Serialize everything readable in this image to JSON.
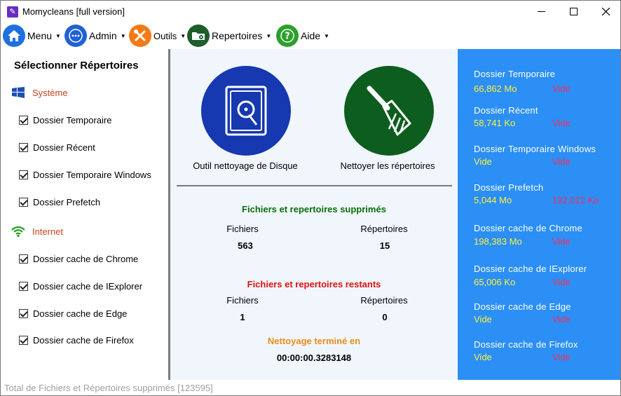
{
  "window": {
    "title": "Momycleans [full version]",
    "controls": {
      "minimize": "—",
      "maximize": "☐",
      "close": "✕"
    }
  },
  "menubar": {
    "items": [
      {
        "label": "Menu",
        "icon": "home-icon",
        "color": "#1e6fe0"
      },
      {
        "label": "Admin",
        "icon": "dots-icon",
        "color": "#1f62d6"
      },
      {
        "label": "Outils",
        "icon": "tools-icon",
        "color": "#f47a14"
      },
      {
        "label": "Repertoires",
        "icon": "folder-gear-icon",
        "color": "#1d5e2b"
      },
      {
        "label": "Aide",
        "icon": "help-icon",
        "color": "#2ca02c"
      }
    ]
  },
  "left": {
    "title": "Sélectionner Répertoires",
    "groups": [
      {
        "label": "Système",
        "icon": "windows-icon",
        "items": [
          "Dossier Temporaire",
          "Dossier Récent",
          "Dossier Temporaire Windows",
          "Dossier Prefetch"
        ]
      },
      {
        "label": "Internet",
        "icon": "wifi-icon",
        "items": [
          "Dossier cache de Chrome",
          "Dossier cache de IExplorer",
          "Dossier cache de Edge",
          "Dossier cache de Firefox"
        ]
      }
    ]
  },
  "center": {
    "disk_tool_label": "Outil nettoyage de Disque",
    "clean_dirs_label": "Nettoyer les répertoires",
    "deleted_title": "Fichiers et repertoires supprimés",
    "remaining_title": "Fichiers et repertoires restants",
    "col_files": "Fichiers",
    "col_dirs": "Répertoires",
    "deleted_files": "563",
    "deleted_dirs": "15",
    "remaining_files": "1",
    "remaining_dirs": "0",
    "done_title": "Nettoyage terminé en",
    "done_time": "00:00:00.3283148",
    "colors": {
      "deleted": "#0a6e0a",
      "remaining": "#e01010",
      "done": "#f08a1a",
      "disk_circle": "#1638b0",
      "broom_circle": "#0d5e1e"
    }
  },
  "right": {
    "items": [
      {
        "name": "Dossier Temporaire",
        "v1": "66,862 Mo",
        "v2": "Vide"
      },
      {
        "name": "Dossier Récent",
        "v1": "58,741 Ko",
        "v2": "Vide"
      },
      {
        "name": "Dossier Temporaire Windows",
        "v1": "Vide",
        "v2": "Vide"
      },
      {
        "name": "Dossier Prefetch",
        "v1": "5,044 Mo",
        "v2": "192,012 Ko"
      },
      {
        "name": "Dossier cache de Chrome",
        "v1": "198,383 Mo",
        "v2": "Vide"
      },
      {
        "name": "Dossier cache de IExplorer",
        "v1": "65,006 Ko",
        "v2": "Vide"
      },
      {
        "name": "Dossier cache de Edge",
        "v1": "Vide",
        "v2": "Vide"
      },
      {
        "name": "Dossier cache de Firefox",
        "v1": "Vide",
        "v2": "Vide"
      }
    ]
  },
  "status": {
    "text": "Total de Fichiers et Répertoires supprimés [123595]"
  }
}
